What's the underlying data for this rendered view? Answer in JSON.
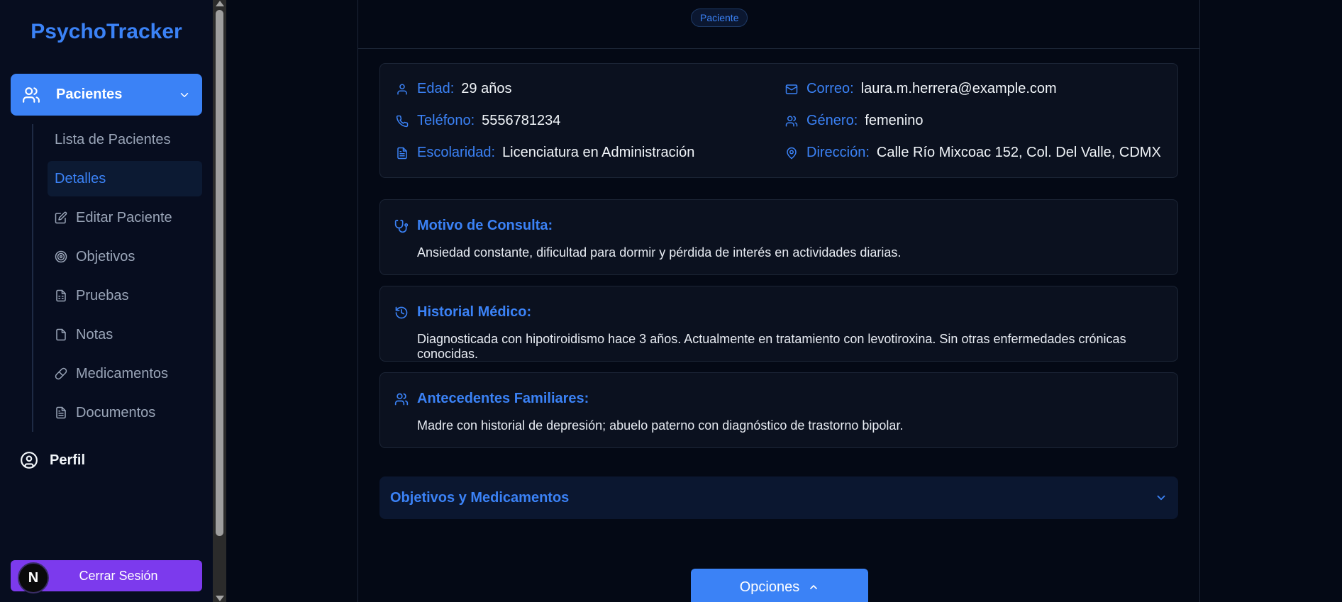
{
  "app": {
    "title": "PsychoTracker"
  },
  "sidebar": {
    "main_item": {
      "label": "Pacientes",
      "icon": "users-icon"
    },
    "sub_items": [
      {
        "label": "Lista de Pacientes",
        "icon": "",
        "active": false
      },
      {
        "label": "Detalles",
        "icon": "",
        "active": true
      },
      {
        "label": "Editar Paciente",
        "icon": "edit-icon",
        "active": false
      },
      {
        "label": "Objetivos",
        "icon": "target-icon",
        "active": false
      },
      {
        "label": "Pruebas",
        "icon": "clipboard-icon",
        "active": false
      },
      {
        "label": "Notas",
        "icon": "file-icon",
        "active": false
      },
      {
        "label": "Medicamentos",
        "icon": "pill-icon",
        "active": false
      },
      {
        "label": "Documentos",
        "icon": "file-text-icon",
        "active": false
      }
    ],
    "profile": {
      "label": "Perfil",
      "icon": "user-circle-icon"
    },
    "logout": {
      "label": "Cerrar Sesión",
      "badge": "N"
    }
  },
  "header": {
    "role_badge": "Paciente"
  },
  "patient_info": {
    "edad": {
      "label": "Edad:",
      "value": "29 años"
    },
    "telefono": {
      "label": "Teléfono:",
      "value": "5556781234"
    },
    "escolaridad": {
      "label": "Escolaridad:",
      "value": "Licenciatura en Administración"
    },
    "correo": {
      "label": "Correo:",
      "value": "laura.m.herrera@example.com"
    },
    "genero": {
      "label": "Género:",
      "value": "femenino"
    },
    "direccion": {
      "label": "Dirección:",
      "value": "Calle Río Mixcoac 152, Col. Del Valle, CDMX"
    }
  },
  "sections": {
    "motivo": {
      "title": "Motivo de Consulta:",
      "body": "Ansiedad constante, dificultad para dormir y pérdida de interés en actividades diarias."
    },
    "historial": {
      "title": "Historial Médico:",
      "body": "Diagnosticada con hipotiroidismo hace 3 años. Actualmente en tratamiento con levotiroxina. Sin otras enfermedades crónicas conocidas."
    },
    "antecedentes": {
      "title": "Antecedentes Familiares:",
      "body": "Madre con historial de depresión; abuelo paterno con diagnóstico de trastorno bipolar."
    }
  },
  "accordion": {
    "label": "Objetivos y Medicamentos"
  },
  "options_button": {
    "label": "Opciones"
  },
  "colors": {
    "accent": "#3b82f6",
    "logout": "#7c3aed",
    "background": "#040915",
    "sidebar": "#070d1f",
    "card": "#0b111f"
  }
}
